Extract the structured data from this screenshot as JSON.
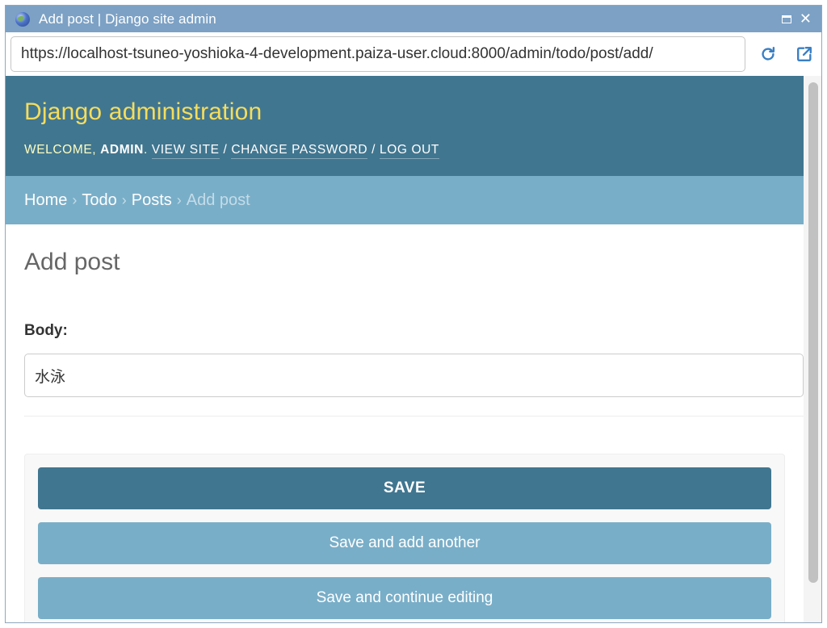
{
  "window": {
    "title": "Add post | Django site admin"
  },
  "browser": {
    "url": "https://localhost-tsuneo-yoshioka-4-development.paiza-user.cloud:8000/admin/todo/post/add/"
  },
  "header": {
    "site_name": "Django administration",
    "welcome": "Welcome,",
    "user_name": "admin",
    "links": {
      "view_site": "View site",
      "change_password": "Change password",
      "log_out": "Log out"
    },
    "separator": "/"
  },
  "breadcrumbs": {
    "items": [
      "Home",
      "Todo",
      "Posts"
    ],
    "current": "Add post",
    "separator": "›"
  },
  "content": {
    "title": "Add post",
    "body_label": "Body:",
    "body_value": "水泳"
  },
  "buttons": {
    "save": "SAVE",
    "save_add_another": "Save and add another",
    "save_continue": "Save and continue editing"
  },
  "colors": {
    "header_bg": "#417690",
    "site_name": "#f5dd5d",
    "breadcrumb_bg": "#79aec8",
    "titlebar_bg": "#7ca1c5"
  }
}
